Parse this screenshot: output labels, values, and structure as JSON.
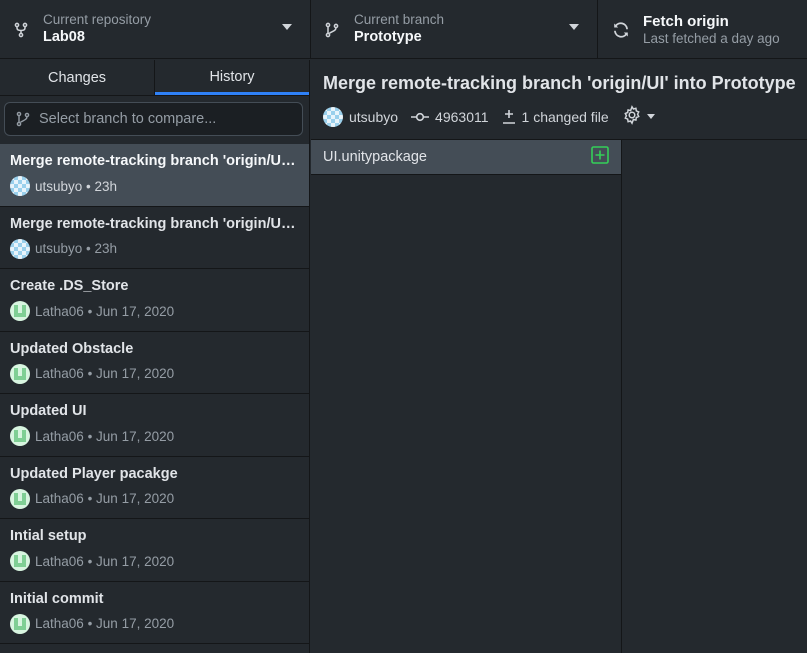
{
  "toolbar": {
    "repo_label": "Current repository",
    "repo_value": "Lab08",
    "branch_label": "Current branch",
    "branch_value": "Prototype",
    "fetch_label": "Fetch origin",
    "fetch_sub": "Last fetched a day ago"
  },
  "tabs": {
    "changes": "Changes",
    "history": "History"
  },
  "compare": {
    "placeholder": "Select branch to compare..."
  },
  "commits": [
    {
      "title": "Merge remote-tracking branch 'origin/UI' into Prototype",
      "author": "utsubyo",
      "time": "23h",
      "avatar": "utsubyo"
    },
    {
      "title": "Merge remote-tracking branch 'origin/UI' into Prototype",
      "author": "utsubyo",
      "time": "23h",
      "avatar": "utsubyo"
    },
    {
      "title": "Create .DS_Store",
      "author": "Latha06",
      "time": "Jun 17, 2020",
      "avatar": "latha"
    },
    {
      "title": "Updated Obstacle",
      "author": "Latha06",
      "time": "Jun 17, 2020",
      "avatar": "latha"
    },
    {
      "title": "Updated UI",
      "author": "Latha06",
      "time": "Jun 17, 2020",
      "avatar": "latha"
    },
    {
      "title": "Updated Player pacakge",
      "author": "Latha06",
      "time": "Jun 17, 2020",
      "avatar": "latha"
    },
    {
      "title": "Intial setup",
      "author": "Latha06",
      "time": "Jun 17, 2020",
      "avatar": "latha"
    },
    {
      "title": "Initial commit",
      "author": "Latha06",
      "time": "Jun 17, 2020",
      "avatar": "latha"
    }
  ],
  "selected_commit": {
    "summary": "Merge remote-tracking branch 'origin/UI' into Prototype",
    "author": "utsubyo",
    "sha": "4963011",
    "files_changed": "1 changed file"
  },
  "files": [
    {
      "name": "UI.unitypackage",
      "status": "added"
    }
  ],
  "colors": {
    "accent": "#2f81f7",
    "added": "#34d058",
    "background": "#24292e",
    "selected": "#444d56"
  }
}
